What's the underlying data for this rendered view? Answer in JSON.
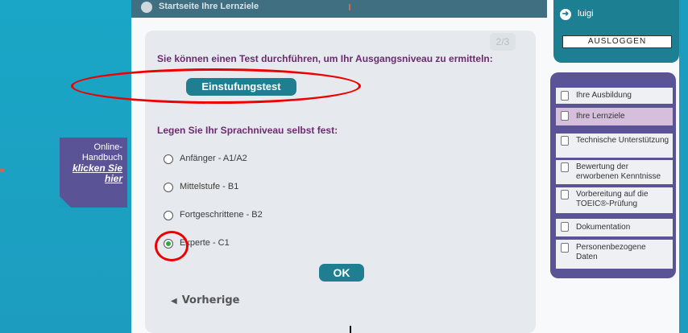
{
  "header": {
    "title": "Startseite Ihre Lernziele"
  },
  "page_indicator": "2/3",
  "placement": {
    "heading": "Sie können einen Test durchführen, um Ihr Ausgangsniveau zu ermitteln:",
    "button_label": "Einstufungstest"
  },
  "level": {
    "heading": "Legen Sie Ihr Sprachniveau selbst fest:",
    "options": [
      {
        "label": "Anfänger - A1/A2",
        "selected": false
      },
      {
        "label": "Mittelstufe - B1",
        "selected": false
      },
      {
        "label": "Fortgeschrittene - B2",
        "selected": false
      },
      {
        "label": "Experte - C1",
        "selected": true
      }
    ]
  },
  "actions": {
    "ok_label": "OK",
    "prev_label": "Vorherige"
  },
  "handbook": {
    "line1": "Online-",
    "line2": "Handbuch",
    "link1": "klicken Sie",
    "link2": "hier"
  },
  "user": {
    "name": "luigi",
    "logout_label": "AUSLOGGEN"
  },
  "nav": {
    "items": [
      {
        "label": "Ihre Ausbildung",
        "active": false
      },
      {
        "label": "Ihre Lernziele",
        "active": true
      },
      {
        "label": "Technische Unterstützung",
        "active": false
      },
      {
        "label": "Bewertung der erworbenen Kenntnisse",
        "active": false
      },
      {
        "label": "Vorbereitung auf die TOEIC®-Prüfung",
        "active": false
      },
      {
        "label": "Dokumentation",
        "active": false
      },
      {
        "label": "Personenbezogene Daten",
        "active": false
      }
    ]
  },
  "colors": {
    "accent": "#1f7f91",
    "heading": "#6d2a6f",
    "nav_bg": "#5a5497",
    "annotation": "#e00000"
  }
}
